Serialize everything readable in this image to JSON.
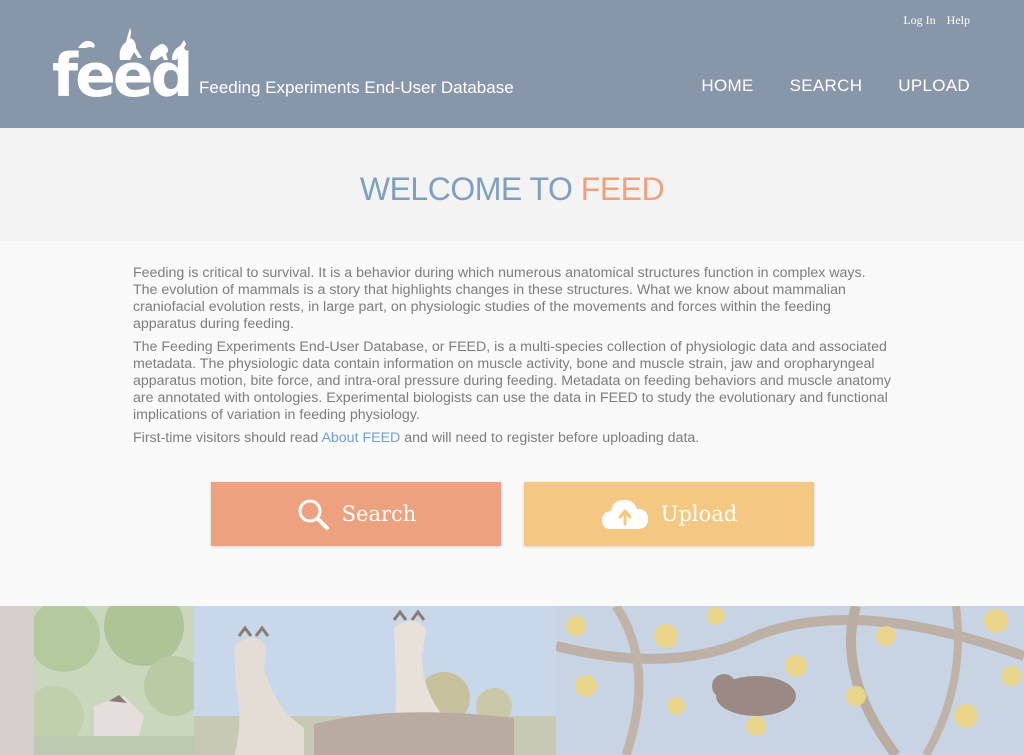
{
  "header": {
    "logo_text": "feed",
    "tagline": "Feeding Experiments End-User Database",
    "top_links": {
      "login": "Log In",
      "help": "Help"
    },
    "nav": {
      "home": "HOME",
      "search": "SEARCH",
      "upload": "UPLOAD"
    }
  },
  "welcome": {
    "part1": "WELCOME TO ",
    "part2": "FEED"
  },
  "intro": {
    "p1": "Feeding is critical to survival. It is a behavior during which numerous anatomical structures function in complex ways. The evolution of mammals is a story that highlights changes in these structures. What we know about mammalian craniofacial evolution rests, in large part, on physiologic studies of the movements and forces within the feeding apparatus during feeding.",
    "p2": "The Feeding Experiments End-User Database, or FEED, is a multi-species collection of physiologic data and associated metadata. The physiologic data contain information on muscle activity, bone and muscle strain, jaw and oropharyngeal apparatus motion, bite force, and intra-oral pressure during feeding. Metadata on feeding behaviors and muscle anatomy are annotated with ontologies. Experimental biologists can use the data in FEED to study the evolutionary and functional implications of variation in feeding physiology.",
    "p3_before": "First-time visitors should read ",
    "p3_link": "About FEED",
    "p3_after": " and will need to register before uploading data."
  },
  "buttons": {
    "search": "Search",
    "upload": "Upload"
  },
  "colors": {
    "header_bg": "#8896aa",
    "welcome_blue": "#7e9fc0",
    "welcome_orange": "#f0a07a",
    "search_button": "#eda17f",
    "upload_button": "#f4c882",
    "link": "#6fa0cc"
  },
  "icons": {
    "search": "magnifier-icon",
    "upload": "cloud-upload-icon"
  }
}
